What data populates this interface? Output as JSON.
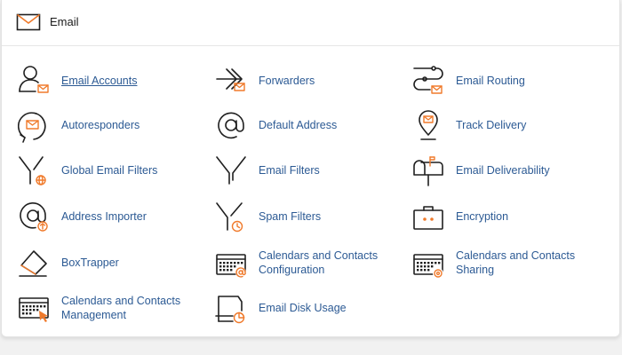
{
  "section": {
    "title": "Email",
    "icon": "envelope-icon"
  },
  "items": [
    {
      "label": "Email Accounts",
      "icon": "user-mail-icon"
    },
    {
      "label": "Forwarders",
      "icon": "forward-arrows-icon"
    },
    {
      "label": "Email Routing",
      "icon": "routing-icon"
    },
    {
      "label": "Autoresponders",
      "icon": "autoresponder-icon"
    },
    {
      "label": "Default Address",
      "icon": "at-sign-icon"
    },
    {
      "label": "Track Delivery",
      "icon": "location-pin-icon"
    },
    {
      "label": "Global Email Filters",
      "icon": "funnel-globe-icon"
    },
    {
      "label": "Email Filters",
      "icon": "funnel-icon"
    },
    {
      "label": "Email Deliverability",
      "icon": "mailbox-icon"
    },
    {
      "label": "Address Importer",
      "icon": "at-import-icon"
    },
    {
      "label": "Spam Filters",
      "icon": "funnel-clock-icon"
    },
    {
      "label": "Encryption",
      "icon": "briefcase-lock-icon"
    },
    {
      "label": "BoxTrapper",
      "icon": "box-trap-icon"
    },
    {
      "label": "Calendars and Contacts Configuration",
      "label_line1": "Calendars and Contacts",
      "label_line2": "Configuration",
      "icon": "calendar-at-icon"
    },
    {
      "label": "Calendars and Contacts Sharing",
      "label_line1": "Calendars and Contacts",
      "label_line2": "Sharing",
      "icon": "calendar-gear-icon"
    },
    {
      "label": "Calendars and Contacts Management",
      "label_line1": "Calendars and Contacts",
      "label_line2": "Management",
      "icon": "calendar-cursor-icon"
    },
    {
      "label": "Email Disk Usage",
      "icon": "disk-usage-icon"
    }
  ],
  "colors": {
    "link": "#2c5a94",
    "accent": "#f07a2b",
    "icon": "#1f1f1f"
  }
}
